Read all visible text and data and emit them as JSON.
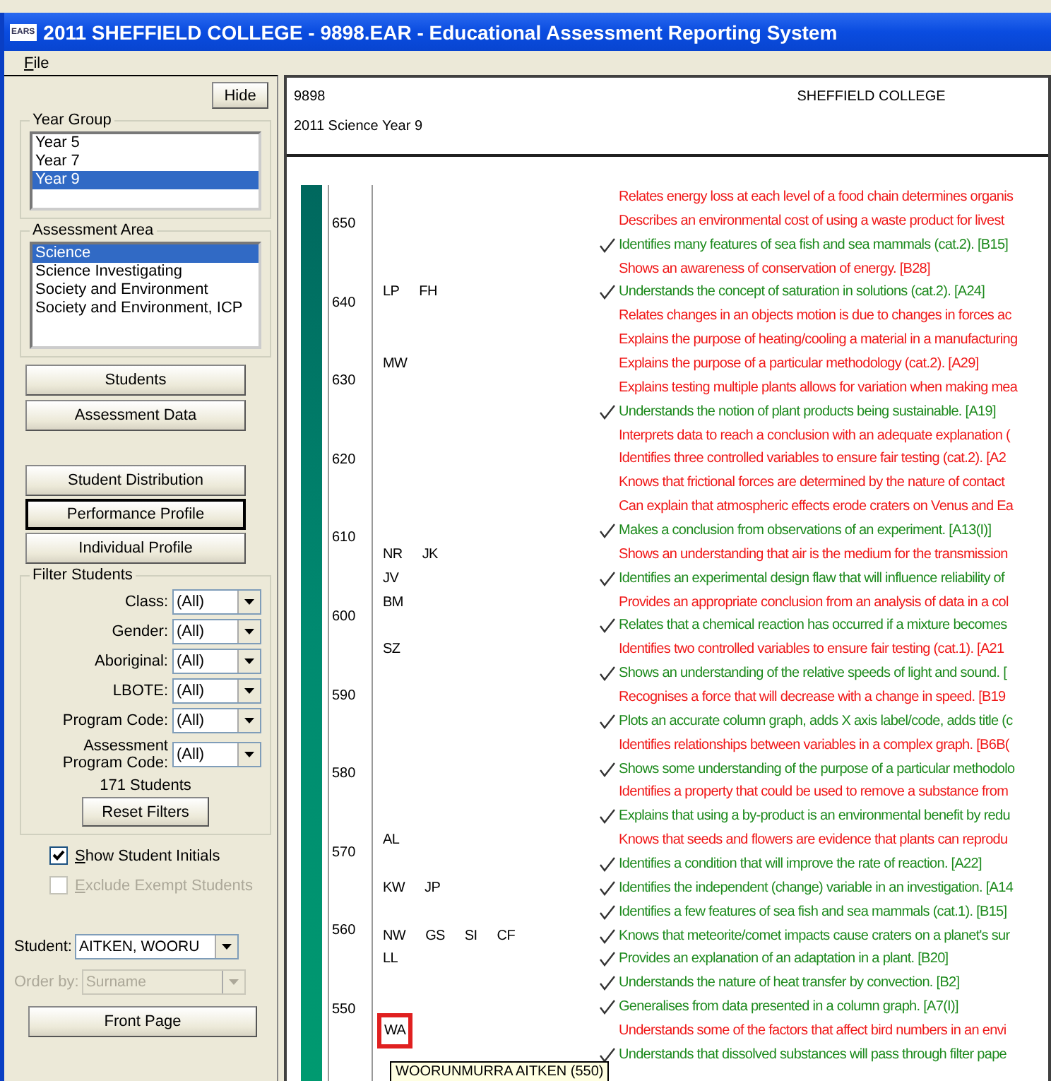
{
  "window": {
    "title": "2011 SHEFFIELD COLLEGE - 9898.EAR - Educational Assessment Reporting System",
    "icon_text": "EARS"
  },
  "menu": [
    "File"
  ],
  "sidebar": {
    "hide_button": "Hide",
    "year_group": {
      "title": "Year Group",
      "items": [
        {
          "label": "Year 5",
          "selected": false
        },
        {
          "label": "Year 7",
          "selected": false
        },
        {
          "label": "Year 9",
          "selected": true
        }
      ]
    },
    "assessment_area": {
      "title": "Assessment Area",
      "items": [
        {
          "label": "Science",
          "selected": true
        },
        {
          "label": "Science Investigating",
          "selected": false
        },
        {
          "label": "Society and Environment",
          "selected": false
        },
        {
          "label": "Society and Environment, ICP",
          "selected": false
        }
      ]
    },
    "data_buttons": [
      "Students",
      "Assessment Data"
    ],
    "report_buttons": [
      {
        "label": "Student Distribution",
        "selected": false
      },
      {
        "label": "Performance Profile",
        "selected": true
      },
      {
        "label": "Individual Profile",
        "selected": false
      }
    ],
    "filter": {
      "title": "Filter Students",
      "filters": [
        {
          "label": "Class:",
          "value": "(All)"
        },
        {
          "label": "Gender:",
          "value": "(All)"
        },
        {
          "label": "Aboriginal:",
          "value": "(All)"
        },
        {
          "label": "LBOTE:",
          "value": "(All)"
        },
        {
          "label": "Program Code:",
          "value": "(All)"
        },
        {
          "label": "Assessment Program Code:",
          "value": "(All)"
        }
      ],
      "count": "171 Students",
      "reset_button": "Reset Filters"
    },
    "checkboxes": [
      {
        "label": "Show Student Initials",
        "checked": true,
        "disabled": false
      },
      {
        "label": "Exclude Exempt Students",
        "checked": false,
        "disabled": true
      }
    ],
    "selects": [
      {
        "label": "Student:",
        "value": "AITKEN, WOORU",
        "disabled": false
      },
      {
        "label": "Order by:",
        "value": "Surname",
        "disabled": true
      }
    ],
    "front_page_button": "Front Page"
  },
  "report": {
    "code": "9898",
    "school": "SHEFFIELD COLLEGE",
    "subtitle": "2011 Science Year 9",
    "scale": [
      "650",
      "640",
      "630",
      "620",
      "610",
      "600",
      "590",
      "580",
      "570",
      "560",
      "550"
    ],
    "rows": [
      {
        "text": "Relates energy loss at each level of a food chain determines organis",
        "achieved": false
      },
      {
        "text": "Describes an environmental cost of using a waste product for livest",
        "achieved": false
      },
      {
        "text": "Identifies many features of sea fish and sea mammals (cat.2). [B15]",
        "achieved": true
      },
      {
        "text": "Shows an awareness of conservation of energy. [B28]",
        "achieved": false
      },
      {
        "text": "Understands the concept of saturation in solutions (cat.2). [A24]",
        "achieved": true,
        "initials": [
          {
            "text": "LP",
            "highlighted": false
          },
          {
            "text": "FH",
            "highlighted": false
          }
        ]
      },
      {
        "text": "Relates changes in an objects motion is due to changes in forces ac",
        "achieved": false
      },
      {
        "text": "Explains the purpose of heating/cooling a material in a manufacturing",
        "achieved": false
      },
      {
        "text": "Explains the purpose of a particular methodology (cat.2). [A29]",
        "achieved": false,
        "initials": [
          {
            "text": "MW",
            "highlighted": false
          }
        ]
      },
      {
        "text": "Explains testing multiple plants allows for variation when making mea",
        "achieved": false
      },
      {
        "text": "Understands the notion of plant products being sustainable. [A19]",
        "achieved": true
      },
      {
        "text": "Interprets data to reach a conclusion with an adequate explanation (",
        "achieved": false
      },
      {
        "text": "Identifies three controlled variables to ensure fair testing (cat.2). [A2",
        "achieved": false
      },
      {
        "text": "Knows that frictional forces are determined by the nature of contact",
        "achieved": false
      },
      {
        "text": "Can explain that atmospheric effects erode craters on Venus and Ea",
        "achieved": false
      },
      {
        "text": "Makes a conclusion from observations of an experiment. [A13(I)]",
        "achieved": true
      },
      {
        "text": "Shows an understanding that air is the medium for the transmission",
        "achieved": false,
        "initials": [
          {
            "text": "NR",
            "highlighted": false
          },
          {
            "text": "JK",
            "highlighted": false
          }
        ]
      },
      {
        "text": "Identifies an experimental design flaw that will influence reliability of",
        "achieved": true,
        "initials": [
          {
            "text": "JV",
            "highlighted": false
          }
        ]
      },
      {
        "text": "Provides an appropriate conclusion from an analysis of data in a col",
        "achieved": false,
        "initials": [
          {
            "text": "BM",
            "highlighted": false
          }
        ]
      },
      {
        "text": "Relates that a chemical reaction has occurred if a mixture becomes",
        "achieved": true
      },
      {
        "text": "Identifies two controlled variables to ensure fair testing (cat.1). [A21",
        "achieved": false,
        "initials": [
          {
            "text": "SZ",
            "highlighted": false
          }
        ]
      },
      {
        "text": "Shows an understanding of the relative speeds of light and sound. [",
        "achieved": true
      },
      {
        "text": "Recognises a force that will decrease with a change in speed. [B19",
        "achieved": false
      },
      {
        "text": "Plots an accurate column graph, adds X axis label/code, adds title (c",
        "achieved": true
      },
      {
        "text": "Identifies relationships between variables in a complex graph. [B6B(",
        "achieved": false
      },
      {
        "text": "Shows some understanding of the purpose of a particular methodolo",
        "achieved": true
      },
      {
        "text": "Identifies a property that could be used to remove a substance from",
        "achieved": false
      },
      {
        "text": "Explains that using a by-product is an environmental benefit by redu",
        "achieved": true
      },
      {
        "text": "Knows that seeds and flowers are evidence that plants can reprodu",
        "achieved": false,
        "initials": [
          {
            "text": "AL",
            "highlighted": false
          }
        ]
      },
      {
        "text": "Identifies a condition that will improve the rate of reaction. [A22]",
        "achieved": true
      },
      {
        "text": "Identifies the independent (change) variable in an investigation. [A14",
        "achieved": true,
        "initials": [
          {
            "text": "KW",
            "highlighted": false
          },
          {
            "text": "JP",
            "highlighted": false
          }
        ]
      },
      {
        "text": "Identifies a few features of sea fish and sea mammals (cat.1). [B15]",
        "achieved": true
      },
      {
        "text": "Knows that meteorite/comet impacts cause craters on a planet's sur",
        "achieved": true,
        "initials": [
          {
            "text": "NW",
            "highlighted": false
          },
          {
            "text": "GS",
            "highlighted": false
          },
          {
            "text": "SI",
            "highlighted": false
          },
          {
            "text": "CF",
            "highlighted": false
          }
        ]
      },
      {
        "text": "Provides an explanation of an adaptation in a plant. [B20]",
        "achieved": true,
        "initials": [
          {
            "text": "LL",
            "highlighted": false
          }
        ]
      },
      {
        "text": "Understands the nature of heat transfer by convection. [B2]",
        "achieved": true
      },
      {
        "text": "Generalises from data presented in a column graph. [A7(I)]",
        "achieved": true
      },
      {
        "text": "Understands some of the factors that affect bird numbers in an envi",
        "achieved": false,
        "initials": [
          {
            "text": "WA",
            "highlighted": true
          }
        ]
      },
      {
        "text": "Understands that dissolved substances will pass through filter pape",
        "achieved": true
      }
    ],
    "tooltip": "WOORUNMURRA AITKEN (550)"
  }
}
